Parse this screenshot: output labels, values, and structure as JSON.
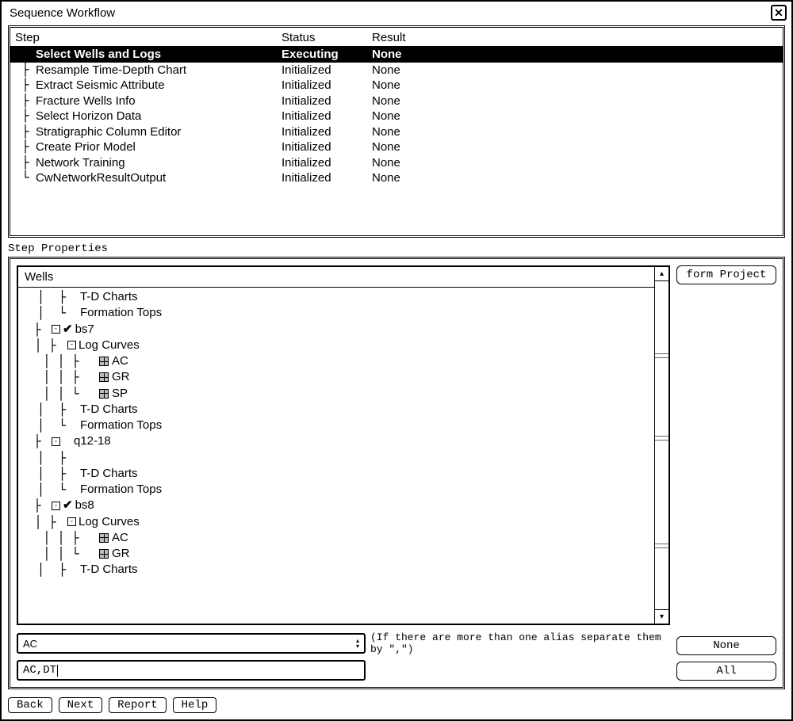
{
  "window": {
    "title": "Sequence Workflow"
  },
  "steps": {
    "headers": {
      "step": "Step",
      "status": "Status",
      "result": "Result"
    },
    "rows": [
      {
        "name": "Select Wells and Logs",
        "status": "Executing",
        "result": "None",
        "selected": true
      },
      {
        "name": "Resample Time-Depth Chart",
        "status": "Initialized",
        "result": "None"
      },
      {
        "name": "Extract Seismic Attribute",
        "status": "Initialized",
        "result": "None"
      },
      {
        "name": "Fracture Wells Info",
        "status": "Initialized",
        "result": "None"
      },
      {
        "name": "Select Horizon Data",
        "status": "Initialized",
        "result": "None"
      },
      {
        "name": "Stratigraphic Column Editor",
        "status": "Initialized",
        "result": "None"
      },
      {
        "name": "Create Prior Model",
        "status": "Initialized",
        "result": "None"
      },
      {
        "name": "Network Training",
        "status": "Initialized",
        "result": "None"
      },
      {
        "name": "CwNetworkResultOutput",
        "status": "Initialized",
        "result": "None"
      }
    ]
  },
  "propsLabel": "Step Properties",
  "wells": {
    "title": "Wells",
    "tree": {
      "n1": "T-D Charts",
      "n2": "Formation Tops",
      "bs7": "bs7",
      "bs7_log": "Log Curves",
      "bs7_ac": "AC",
      "bs7_gr": "GR",
      "bs7_sp": "SP",
      "bs7_td": "T-D Charts",
      "bs7_ft": "Formation Tops",
      "q12": "q12-18",
      "q12_td": "T-D Charts",
      "q12_ft": "Formation Tops",
      "bs8": "bs8",
      "bs8_log": "Log Curves",
      "bs8_ac": "AC",
      "bs8_gr": "GR",
      "bs8_td": "T-D Charts"
    }
  },
  "buttons": {
    "formProject": "form Project",
    "none": "None",
    "all": "All",
    "back": "Back",
    "next": "Next",
    "report": "Report",
    "help": "Help"
  },
  "combo": {
    "value": "AC",
    "hint": "(If there are more than one alias separate them by \",\")"
  },
  "textInput": {
    "value": "AC,DT"
  }
}
